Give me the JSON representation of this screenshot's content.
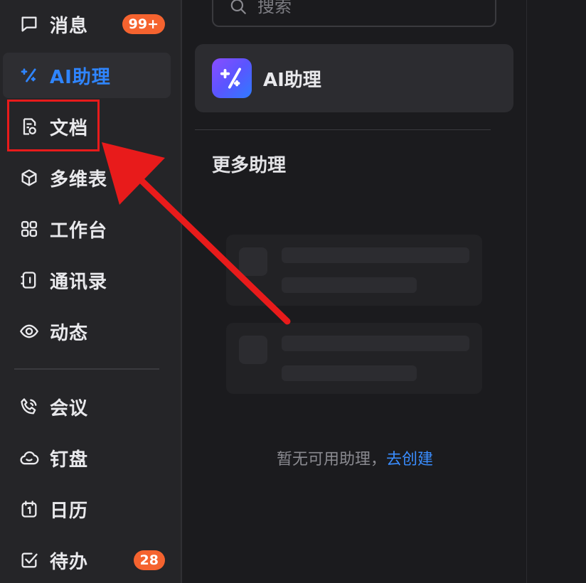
{
  "sidebar": {
    "items": [
      {
        "label": "消息",
        "icon": "chat-bubble-icon",
        "badge": "99+"
      },
      {
        "label": "AI助理",
        "icon": "ai-sparkle-icon",
        "active": true
      },
      {
        "label": "文档",
        "icon": "document-icon"
      },
      {
        "label": "多维表",
        "icon": "cube-icon"
      },
      {
        "label": "工作台",
        "icon": "grid-icon"
      },
      {
        "label": "通讯录",
        "icon": "contacts-book-icon"
      },
      {
        "label": "动态",
        "icon": "eye-icon"
      },
      {
        "label": "会议",
        "icon": "phone-call-icon"
      },
      {
        "label": "钉盘",
        "icon": "cloud-drive-icon"
      },
      {
        "label": "日历",
        "icon": "calendar-icon"
      },
      {
        "label": "待办",
        "icon": "todo-check-icon",
        "badge": "28"
      }
    ]
  },
  "search": {
    "placeholder": "搜索"
  },
  "assistant_card": {
    "name": "AI助理"
  },
  "more_section": {
    "title": "更多助理"
  },
  "empty_state": {
    "text": "暂无可用助理，",
    "link": "去创建"
  },
  "colors": {
    "accent": "#2f85ff",
    "badge": "#f5632f",
    "annotation": "#e81b1b",
    "link": "#3a8dff"
  }
}
